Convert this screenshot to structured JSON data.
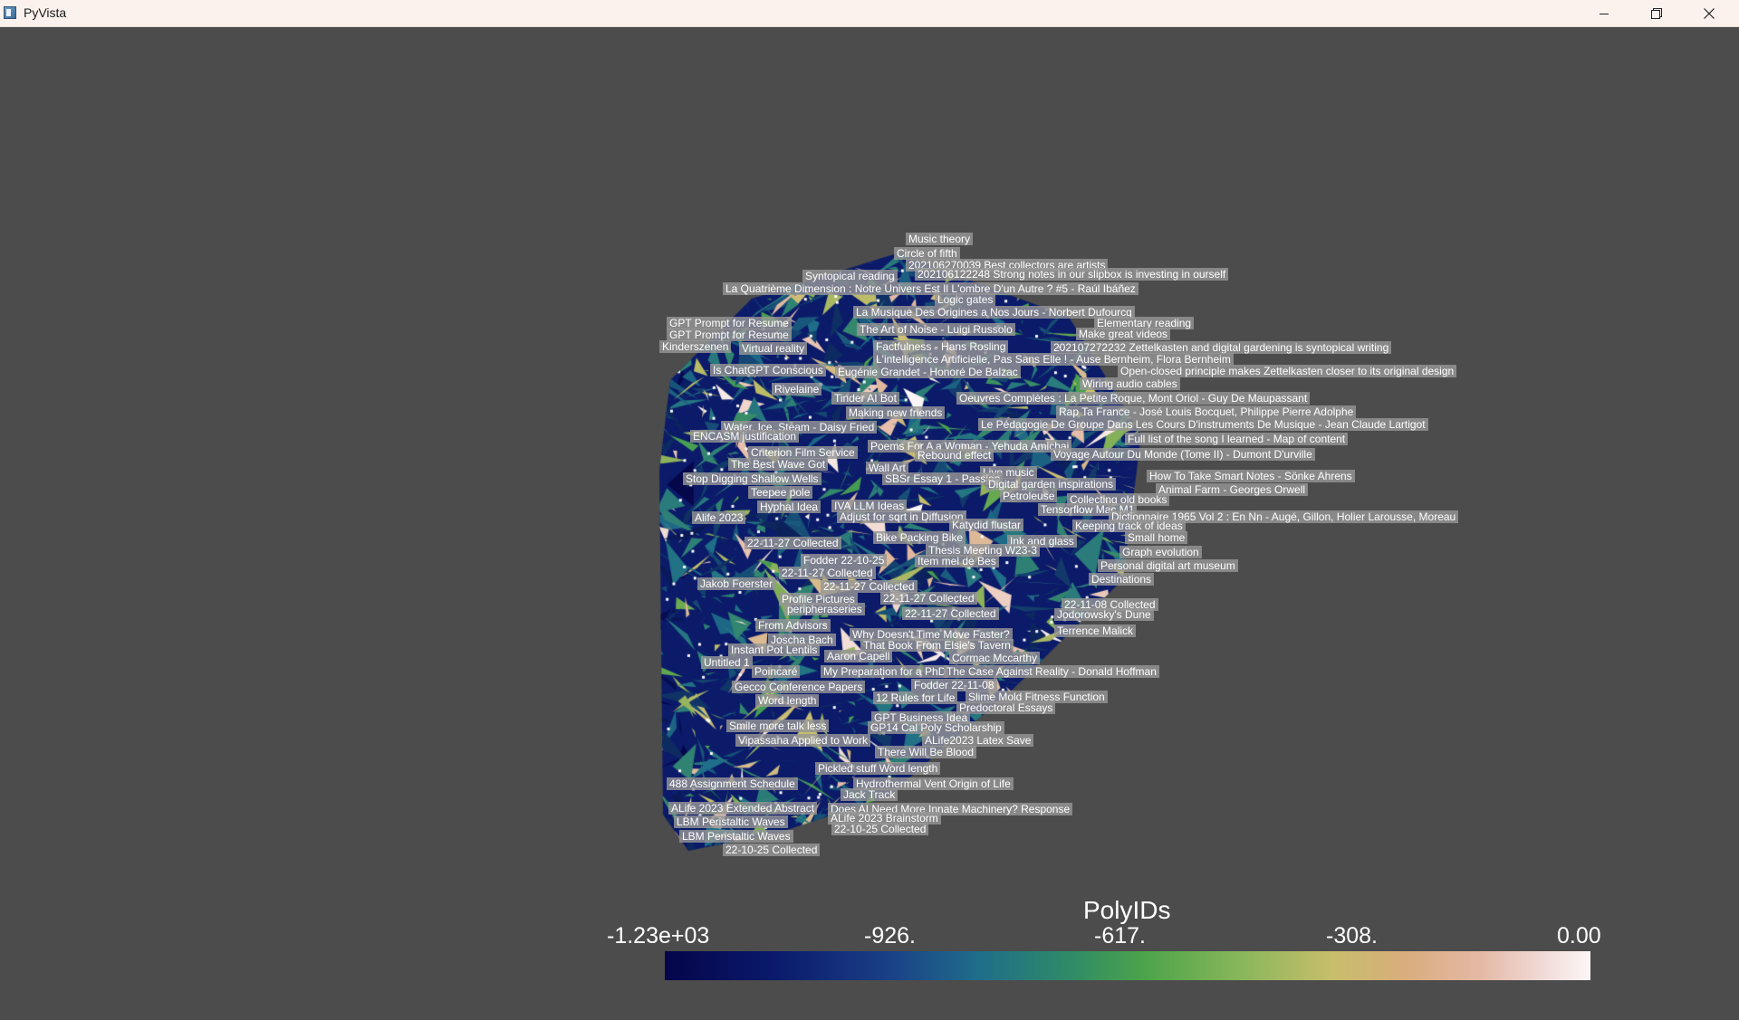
{
  "window": {
    "title": "PyVista",
    "minimize_icon": "minimize-icon",
    "maximize_icon": "restore-icon",
    "close_icon": "close-icon"
  },
  "scalar_bar": {
    "title": "PolyIDs",
    "ticks": [
      "-1.23e+03",
      "-926.",
      "-617.",
      "-308.",
      "0.00"
    ],
    "range": [
      -1230,
      0
    ],
    "colormap_colors": [
      "#05054a",
      "#1f6e8a",
      "#4da44a",
      "#c6be6a",
      "#e4b8a4",
      "#fcf6f6"
    ]
  },
  "labels": [
    "Music theory",
    "Circle of fifth",
    "202106270039 Best collectors are artists",
    "Syntopical reading",
    "202106122248 Strong notes in our slipbox is investing in ourself",
    "La Quatrième Dimension : Notre Univers Est Il L'ombre D'un Autre ? #5 - Raúl Ibáñez",
    "Logic gates",
    "La Musique Des Origines a Nos Jours - Norbert Dufourcq",
    "GPT Prompt for Resume",
    "Elementary reading",
    "GPT Prompt for Resume",
    "The Art of Noise - Luigi Russolo",
    "Make great videos",
    "Kinderszenen",
    "Virtual reality",
    "Factfulness - Hans Rosling",
    "202107272232 Zettelkasten and digital gardening is syntopical writing",
    "L'intelligence Artificielle, Pas Sans Elle ! - Ause Bernheim, Flora Bernheim",
    "Is ChatGPT Conscious",
    "Eugénie Grandet - Honoré De Balzac",
    "Open-closed principle makes Zettelkasten closer to its original design",
    "Wiring audio cables",
    "Rivelaine",
    "Tinder AI Bot",
    "Oeuvres Complètes : La Petite Roque, Mont Oriol - Guy De Maupassant",
    "Rap Ta France - José Louis Bocquet, Philippe Pierre Adolphe",
    "Making new friends",
    "Le Pédagogie De Groupe Dans Les Cours D'instruments De Musique - Jean Claude Lartigot",
    "Water, Ice, Steam - Daisy Fried",
    "ENCASM justification",
    "Full list of the song I learned - Map of content",
    "Poems For A a Woman - Yehuda Amichai",
    "Criterion Film Service",
    "Rebound effect",
    "Voyage Autour Du Monde (Tome II) - Dumont D'urville",
    "The Best Wave Got",
    "Wall Art",
    "How To Take Smart Notes - Sönke Ahrens",
    "Live music",
    "Stop Digging Shallow Wells",
    "SBSr Essay 1 - Passion",
    "Digital garden inspirations",
    "Animal Farm - Georges Orwell",
    "Teepee pole",
    "Petroleuse",
    "Collecting old books",
    "Hyphal Idea",
    "IVA LLM Ideas",
    "Tensorflow Mac M1",
    "Dictionnaire 1965 Vol 2 : En Nn - Augé, Gillon, Holier Larousse, Moreau",
    "Adjust for sqrt in Diffusion",
    "Alife 2023",
    "Katydid flustar",
    "Keeping track of ideas",
    "Small home",
    "Bike Packing Bike",
    "Ink and glass",
    "22-11-27 Collected",
    "Graph evolution",
    "Thesis Meeting W23-3",
    "Fodder 22-10-25",
    "Item mel de Bes",
    "Personal digital art museum",
    "22-11-27 Collected",
    "Destinations",
    "Jakob Foerster",
    "22-11-27 Collected",
    "Profile Pictures",
    "22-11-27 Collected",
    "peripheraseries",
    "22-11-08 Collected",
    "22-11-27 Collected",
    "Jodorowsky's Dune",
    "From Advisors",
    "Terrence Malick",
    "Why Doesn't Time Move Faster?",
    "Joscha Bach",
    "That Book From Elsie's Tavern",
    "Instant Pot Lentils",
    "Aaron Capell",
    "Cormac Mccarthy",
    "Untitled 1",
    "Poincaré",
    "My Preparation for a PhD",
    "The Case Against Reality - Donald Hoffman",
    "Fodder 22-11-08",
    "Gecco Conference Papers",
    "12 Rules for Life",
    "Slime Mold Fitness Function",
    "Word length",
    "Predoctoral Essays",
    "GPT Business Idea",
    "Smile more talk less",
    "GP14 Cal Poly Scholarship",
    "Vipassana Applied to Work",
    "ALife2023 Latex Save",
    "There Will Be Blood",
    "Pickled stuff Word length",
    "488 Assignment Schedule",
    "Hydrothermal Vent Origin of Life",
    "Jack Track",
    "ALife 2023 Extended Abstract",
    "Does AI Need More Innate Machinery? Response",
    "ALife 2023 Brainstorm",
    "LBM Peristaltic Waves",
    "22-10-25 Collected",
    "LBM Peristaltic Waves",
    "22-10-25 Collected"
  ]
}
